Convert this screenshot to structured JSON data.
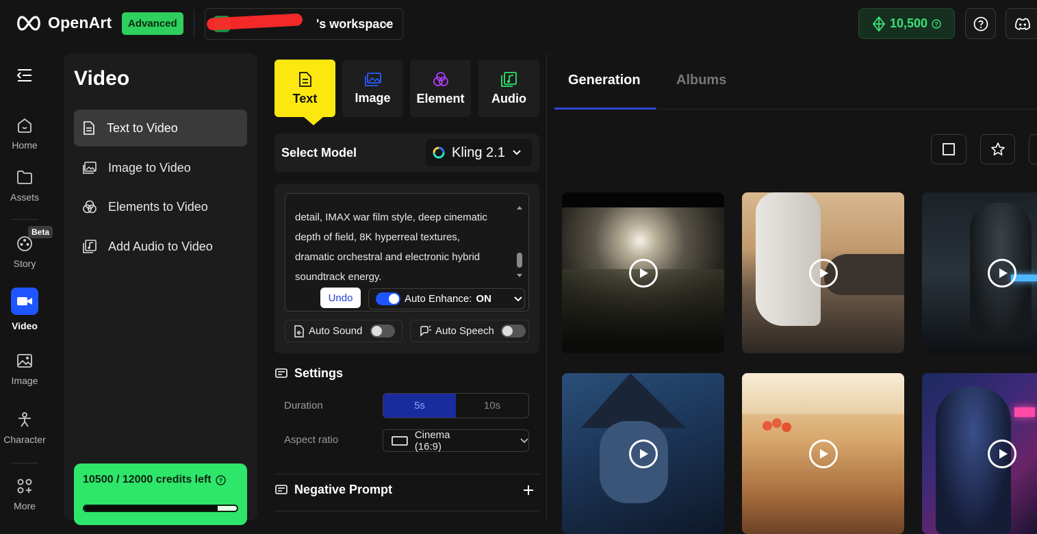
{
  "brand": {
    "name": "OpenArt",
    "plan_badge": "Advanced"
  },
  "workspace": {
    "name": "'s workspace"
  },
  "header": {
    "credits": "10,500"
  },
  "rail": {
    "items": [
      {
        "label": "Home"
      },
      {
        "label": "Assets"
      },
      {
        "label": "Story",
        "badge": "Beta"
      },
      {
        "label": "Video"
      },
      {
        "label": "Image"
      },
      {
        "label": "Character"
      },
      {
        "label": "More"
      }
    ]
  },
  "video_panel": {
    "title": "Video",
    "items": [
      {
        "label": "Text to Video"
      },
      {
        "label": "Image to Video"
      },
      {
        "label": "Elements to Video"
      },
      {
        "label": "Add Audio to Video"
      }
    ],
    "credits_text": "10500 / 12000 credits left",
    "credits_fraction": 0.875
  },
  "modes": [
    {
      "label": "Text"
    },
    {
      "label": "Image"
    },
    {
      "label": "Element"
    },
    {
      "label": "Audio"
    }
  ],
  "model": {
    "label": "Select Model",
    "value": "Kling 2.1"
  },
  "prompt": {
    "text": "detail, IMAX war film style, deep cinematic\ndepth of field, 8K hyperreal textures,\ndramatic orchestral and electronic hybrid\nsoundtrack energy.",
    "undo": "Undo",
    "auto_enhance_label": "Auto Enhance:",
    "auto_enhance_value": "ON",
    "auto_sound": "Auto Sound",
    "auto_speech": "Auto Speech"
  },
  "settings": {
    "title": "Settings",
    "duration_label": "Duration",
    "duration_options": [
      "5s",
      "10s"
    ],
    "aspect_label": "Aspect ratio",
    "aspect_value": "Cinema (16:9)"
  },
  "negative_prompt": {
    "title": "Negative Prompt"
  },
  "gallery": {
    "tabs": [
      "Generation",
      "Albums"
    ]
  },
  "colors": {
    "accent_yellow": "#fce80f",
    "accent_green": "#2ee66a",
    "accent_blue": "#1f55ff"
  }
}
